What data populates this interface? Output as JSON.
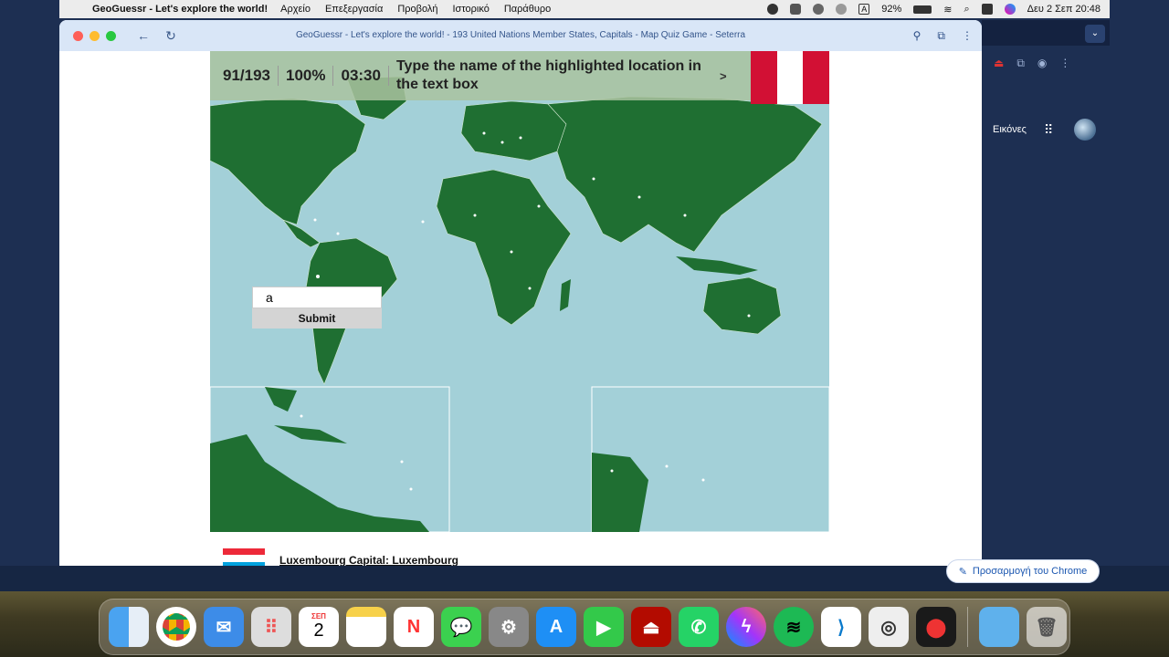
{
  "menubar": {
    "app_name": "GeoGuessr - Let's explore the world!",
    "menus": [
      "Αρχείο",
      "Επεξεργασία",
      "Προβολή",
      "Ιστορικό",
      "Παράθυρο"
    ],
    "battery": "92%",
    "input_source": "A",
    "clock": "Δευ 2 Σεπ  20:48"
  },
  "browser": {
    "window_title": "GeoGuessr - Let's explore the world! - 193 United Nations Member States, Capitals - Map Quiz Game - Seterra"
  },
  "game": {
    "progress": "91/193",
    "accuracy": "100%",
    "timer": "03:30",
    "instruction": "Type the name of the highlighted location in the text box",
    "next_arrow": ">",
    "input_value": "a",
    "submit_label": "Submit",
    "flag_colors": [
      "#d21034",
      "#ffffff",
      "#d21034"
    ]
  },
  "info": {
    "text": "Luxembourg   Capital: Luxembourg",
    "flag_colors": [
      "#ed2939",
      "#ffffff",
      "#00a1de"
    ]
  },
  "sidepanel": {
    "images_label": "Εικόνες",
    "customize_label": "Προσαρμογή του Chrome"
  },
  "dock": {
    "calendar_month": "ΣΕΠ",
    "calendar_day": "2"
  }
}
